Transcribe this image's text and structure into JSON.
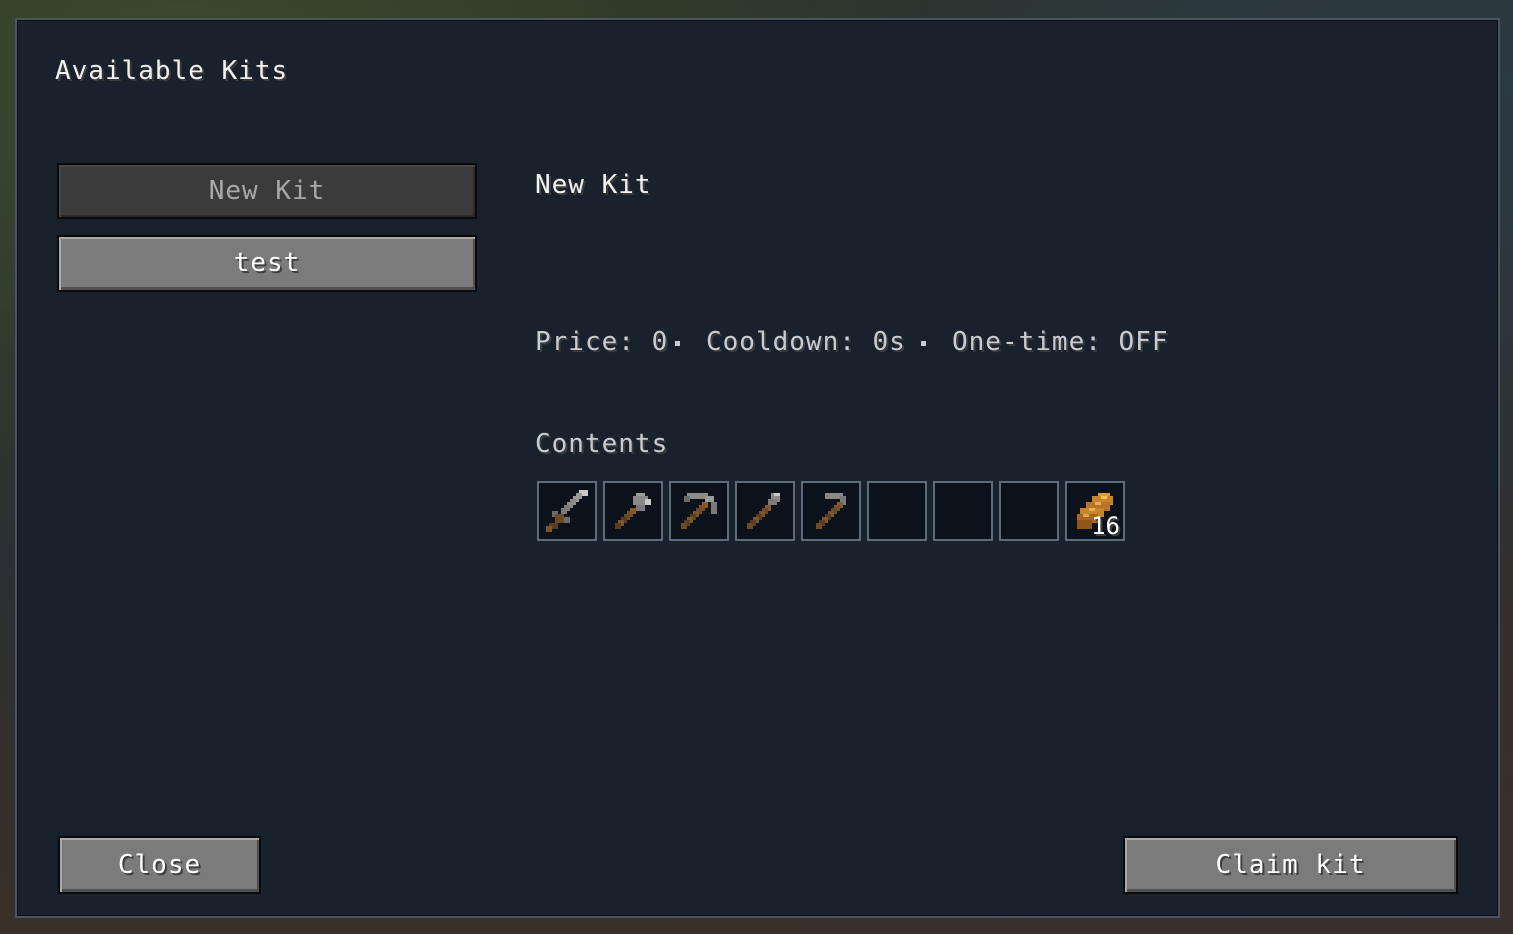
{
  "panel": {
    "title": "Available Kits"
  },
  "kit_list": [
    {
      "label": "New Kit",
      "selected": true
    },
    {
      "label": "test",
      "selected": false
    }
  ],
  "details": {
    "kit_name": "New Kit",
    "price": "Price: 0",
    "cooldown": "Cooldown: 0s",
    "one_time": "One-time: OFF",
    "contents_label": "Contents",
    "slots": [
      {
        "item": "stone-sword-icon",
        "count": ""
      },
      {
        "item": "stone-axe-icon",
        "count": ""
      },
      {
        "item": "stone-pickaxe-icon",
        "count": ""
      },
      {
        "item": "stone-shovel-icon",
        "count": ""
      },
      {
        "item": "stone-hoe-icon",
        "count": ""
      },
      {
        "item": "",
        "count": ""
      },
      {
        "item": "",
        "count": ""
      },
      {
        "item": "",
        "count": ""
      },
      {
        "item": "bread-icon",
        "count": "16"
      }
    ]
  },
  "footer": {
    "close_label": "Close",
    "claim_label": "Claim kit"
  }
}
